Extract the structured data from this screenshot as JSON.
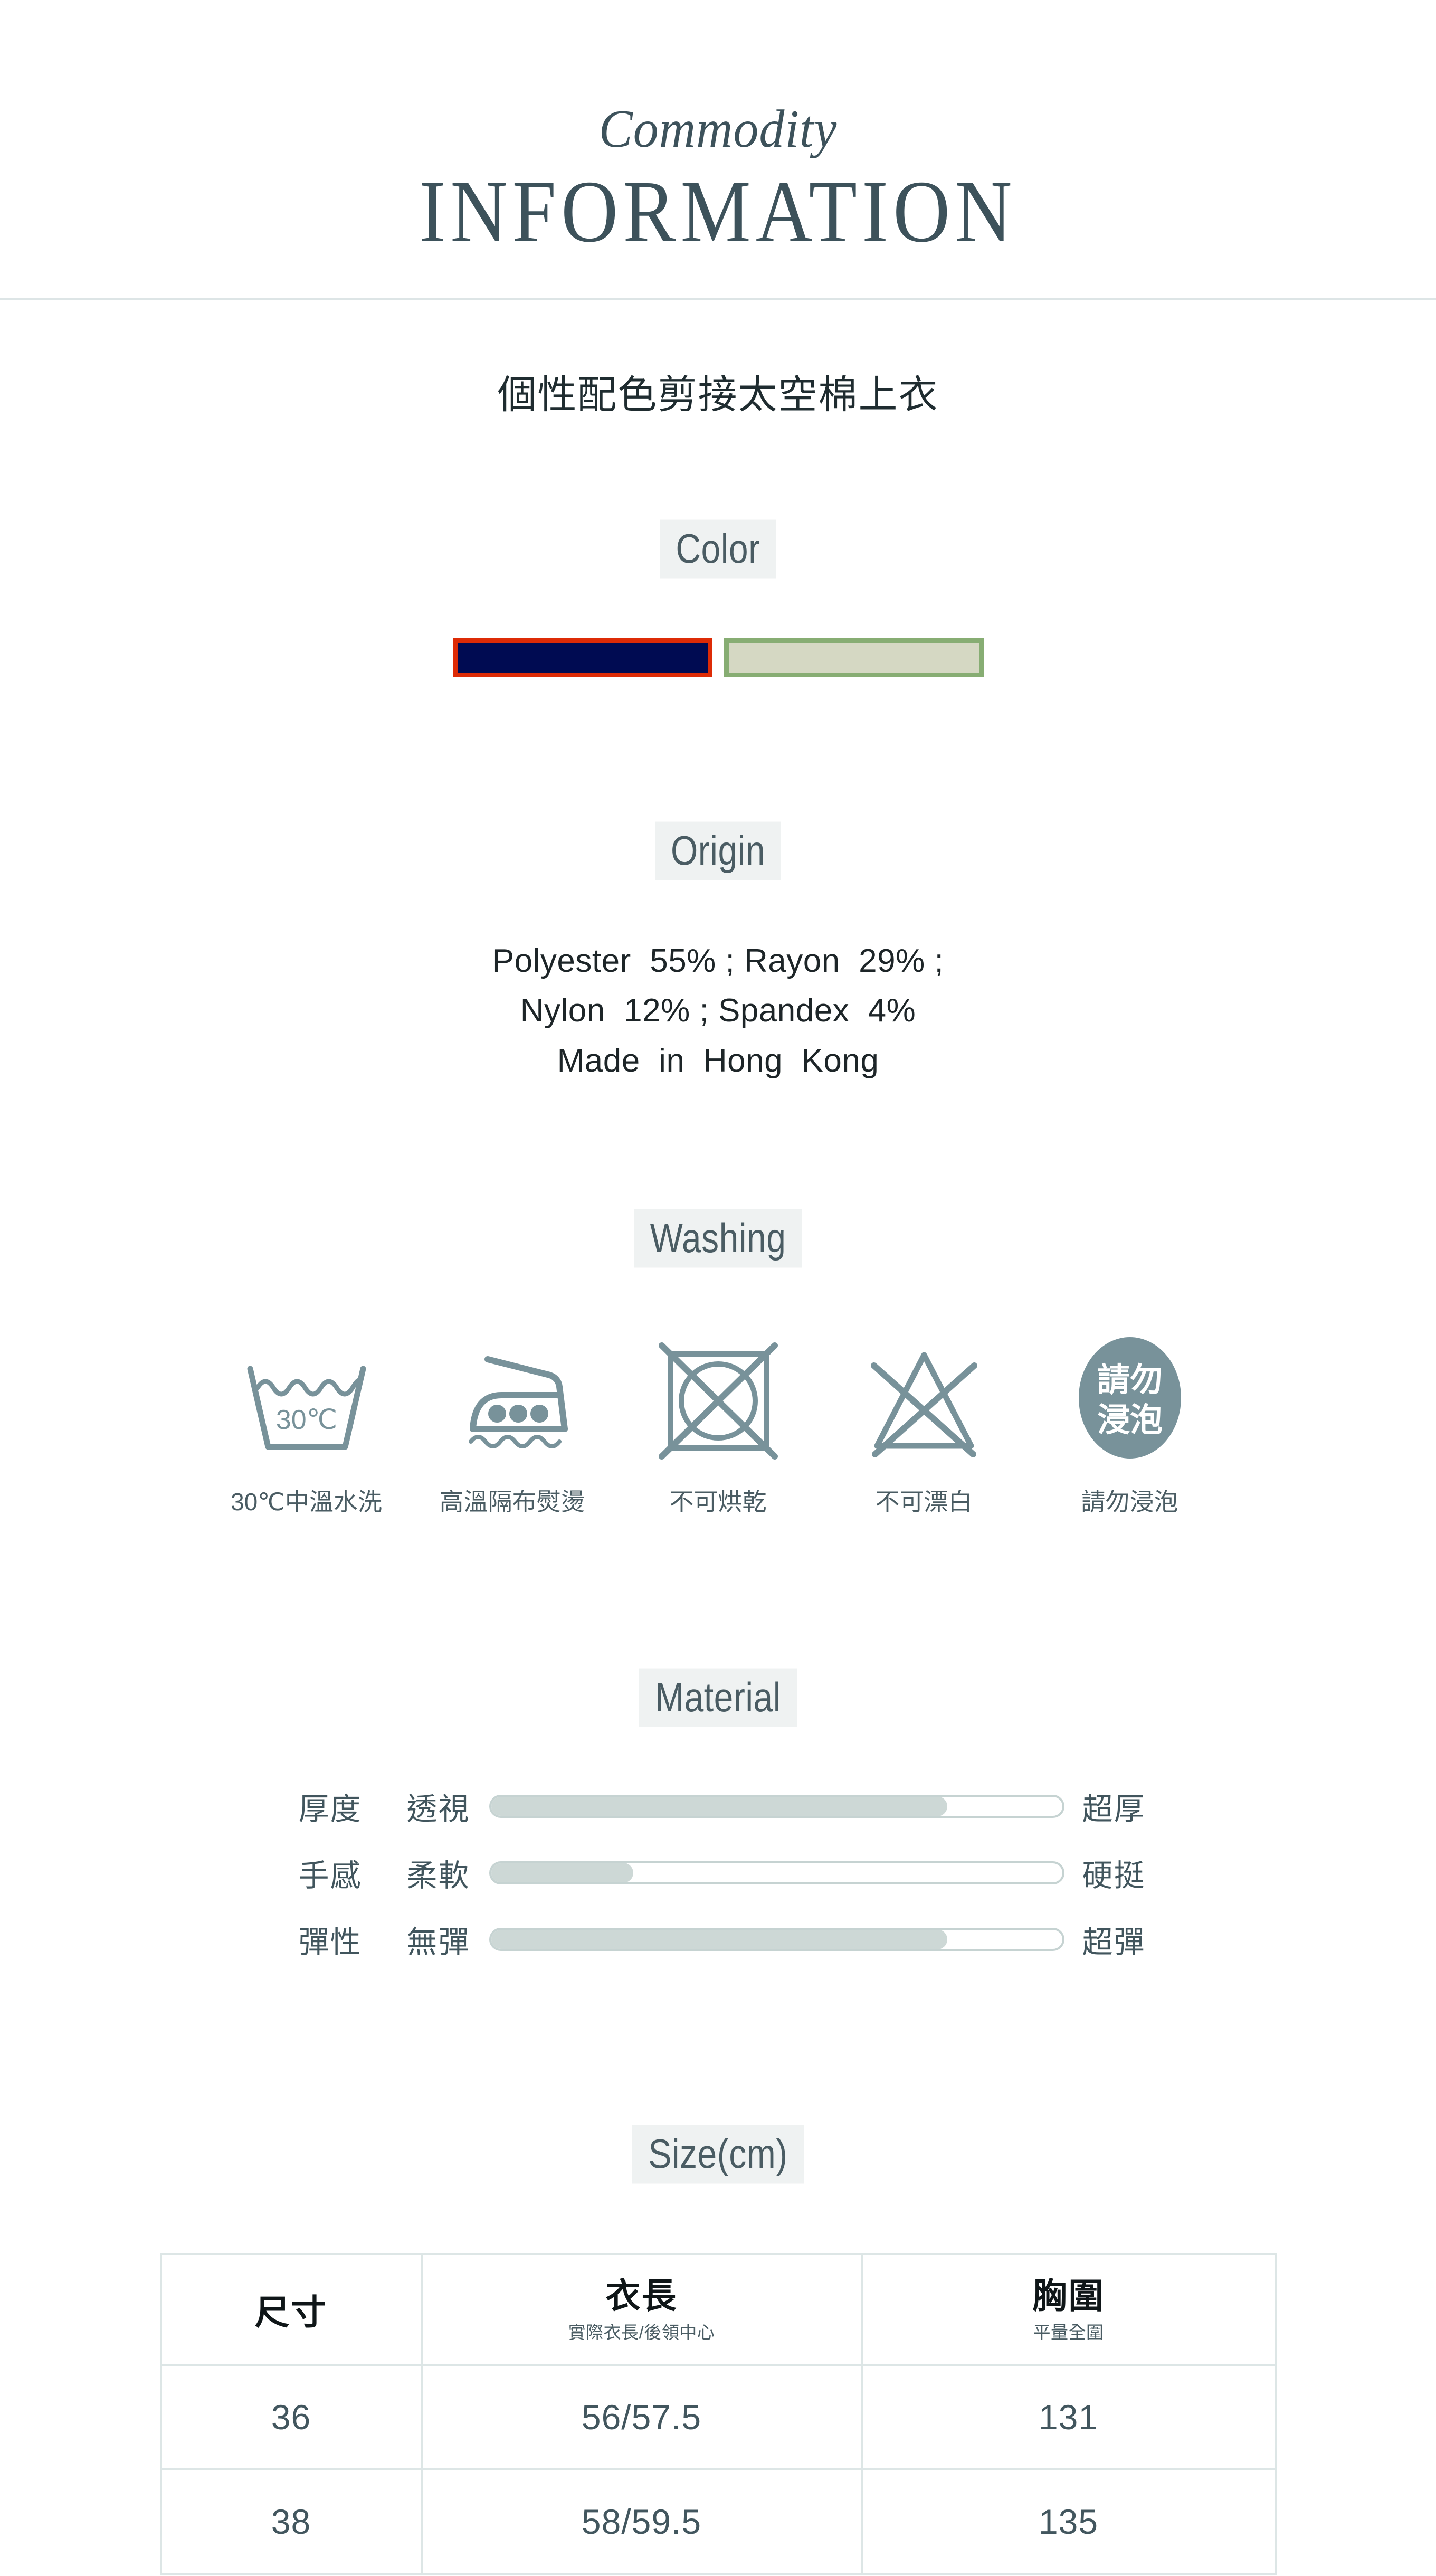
{
  "header": {
    "script_title": "Commodity",
    "main_title": "INFORMATION"
  },
  "product": {
    "name": "個性配色剪接太空棉上衣"
  },
  "color": {
    "section_label": "Color",
    "swatches": [
      {
        "name": "navy-red-swatch",
        "fill": "#000b52",
        "border": "#dd2b06"
      },
      {
        "name": "sage-green-swatch",
        "fill": "#d5d8c3",
        "border": "#87ad73"
      }
    ]
  },
  "origin": {
    "section_label": "Origin",
    "lines": [
      "Polyester  55% ; Rayon  29% ;",
      "Nylon  12% ; Spandex  4%",
      "Made  in  Hong  Kong"
    ]
  },
  "washing": {
    "section_label": "Washing",
    "items": [
      {
        "icon": "wash-basin-30c-icon",
        "icon_text": "30℃",
        "label": "30℃中溫水洗"
      },
      {
        "icon": "iron-three-dots-icon",
        "icon_text": "",
        "label": "高溫隔布熨燙"
      },
      {
        "icon": "no-tumble-dry-icon",
        "icon_text": "",
        "label": "不可烘乾"
      },
      {
        "icon": "no-bleach-icon",
        "icon_text": "",
        "label": "不可漂白"
      },
      {
        "icon": "do-not-soak-icon",
        "icon_text": "請勿\n浸泡",
        "icon_text_line1": "請勿",
        "icon_text_line2": "浸泡",
        "label": "請勿浸泡"
      }
    ]
  },
  "material": {
    "section_label": "Material",
    "rows": [
      {
        "attribute": "厚度",
        "left": "透視",
        "right": "超厚",
        "value": 80
      },
      {
        "attribute": "手感",
        "left": "柔軟",
        "right": "硬挺",
        "value": 25
      },
      {
        "attribute": "彈性",
        "left": "無彈",
        "right": "超彈",
        "value": 80
      }
    ]
  },
  "size": {
    "section_label": "Size(cm)",
    "columns": [
      {
        "main": "尺寸",
        "sub": ""
      },
      {
        "main": "衣長",
        "sub": "實際衣長/後領中心"
      },
      {
        "main": "胸圍",
        "sub": "平量全圍"
      }
    ],
    "rows": [
      {
        "size": "36",
        "length": "56/57.5",
        "bust": "131"
      },
      {
        "size": "38",
        "length": "58/59.5",
        "bust": "135"
      }
    ]
  },
  "colors": {
    "accent_slate": "#3d525b",
    "badge_bg": "#eff2f2",
    "badge_text": "#4a5c63",
    "icon_stroke": "#78929a",
    "table_border": "#dde6e6",
    "slider_fill": "#cdd8d6",
    "divider": "#dde5e6"
  }
}
